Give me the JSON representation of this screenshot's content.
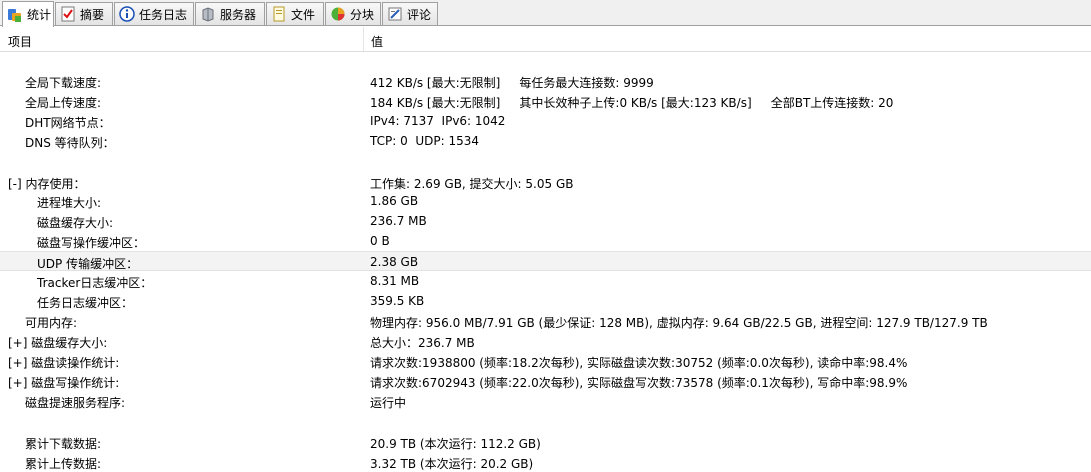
{
  "tabs": [
    {
      "label": "统计",
      "icon": "statistics-icon"
    },
    {
      "label": "摘要",
      "icon": "checklist-icon"
    },
    {
      "label": "任务日志",
      "icon": "info-icon"
    },
    {
      "label": "服务器",
      "icon": "server-icon"
    },
    {
      "label": "文件",
      "icon": "file-icon"
    },
    {
      "label": "分块",
      "icon": "pie-chart-icon"
    },
    {
      "label": "评论",
      "icon": "comment-icon"
    }
  ],
  "header": {
    "col1": "项目",
    "col2": "值"
  },
  "rows": [
    {
      "key": "全局下载速度:",
      "value": "412 KB/s [最大:无限制]     每任务最大连接数: 9999"
    },
    {
      "key": "全局上传速度:",
      "value": "184 KB/s [最大:无限制]     其中长效种子上传:0 KB/s [最大:123 KB/s]     全部BT上传连接数: 20"
    },
    {
      "key": "DHT网络节点：",
      "value": "IPv4: 7137  IPv6: 1042"
    },
    {
      "key": "DNS 等待队列：",
      "value": "TCP: 0  UDP: 1534"
    },
    {
      "key": "[-] 内存使用：",
      "value": "工作集: 2.69 GB, 提交大小: 5.05 GB"
    },
    {
      "key": "进程堆大小:",
      "value": "1.86 GB"
    },
    {
      "key": "磁盘缓存大小:",
      "value": "236.7 MB"
    },
    {
      "key": "磁盘写操作缓冲区：",
      "value": "0 B"
    },
    {
      "key": "UDP 传输缓冲区：",
      "value": "2.38 GB"
    },
    {
      "key": "Tracker日志缓冲区：",
      "value": "8.31 MB"
    },
    {
      "key": "任务日志缓冲区：",
      "value": "359.5 KB"
    },
    {
      "key": "可用内存:",
      "value": "物理内存: 956.0 MB/7.91 GB (最少保证: 128 MB), 虚拟内存: 9.64 GB/22.5 GB, 进程空间: 127.9 TB/127.9 TB"
    },
    {
      "key": "[+] 磁盘缓存大小:",
      "value": "总大小：236.7 MB"
    },
    {
      "key": "[+] 磁盘读操作统计:",
      "value": "请求次数:1938800 (频率:18.2次每秒), 实际磁盘读次数:30752 (频率:0.0次每秒), 读命中率:98.4%"
    },
    {
      "key": "[+] 磁盘写操作统计:",
      "value": "请求次数:6702943 (频率:22.0次每秒), 实际磁盘写次数:73578 (频率:0.1次每秒), 写命中率:98.9%"
    },
    {
      "key": "磁盘提速服务程序:",
      "value": "运行中"
    },
    {
      "key": "累计下载数据:",
      "value": "20.9 TB (本次运行: 112.2 GB)"
    },
    {
      "key": "累计上传数据:",
      "value": "3.32 TB (本次运行: 20.2 GB)"
    }
  ]
}
